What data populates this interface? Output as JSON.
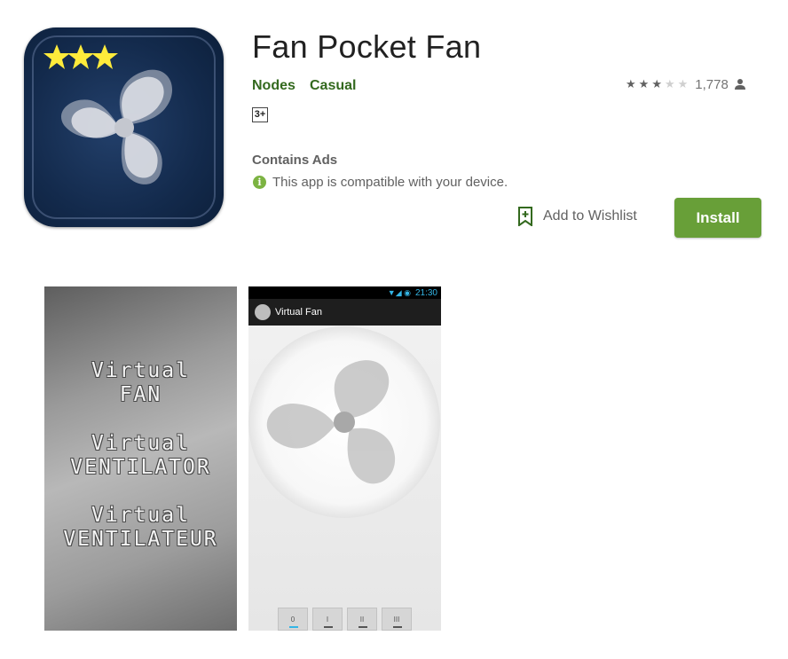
{
  "app": {
    "title": "Fan Pocket Fan",
    "developer": "Nodes",
    "category": "Casual",
    "rating_stars": 3,
    "rating_max": 5,
    "rating_count": "1,778",
    "content_rating": "3+",
    "contains_ads": "Contains Ads",
    "compatibility": "This app is compatible with your device.",
    "wishlist_label": "Add to Wishlist",
    "install_label": "Install"
  },
  "colors": {
    "accent_green": "#689f38",
    "link_green": "#33691e",
    "info_green": "#7cb342",
    "icon_star_yellow": "#ffeb3b"
  },
  "screenshots": [
    {
      "lines": [
        "Virtual",
        "FAN",
        "Virtual",
        "VENTILATOR",
        "Virtual",
        "VENTILATEUR"
      ]
    },
    {
      "status_time": "21:30",
      "status_icons": "wifi-signal-battery",
      "app_bar_title": "Virtual Fan",
      "speed_buttons": [
        "0",
        "I",
        "II",
        "III"
      ],
      "active_speed": "0"
    }
  ]
}
